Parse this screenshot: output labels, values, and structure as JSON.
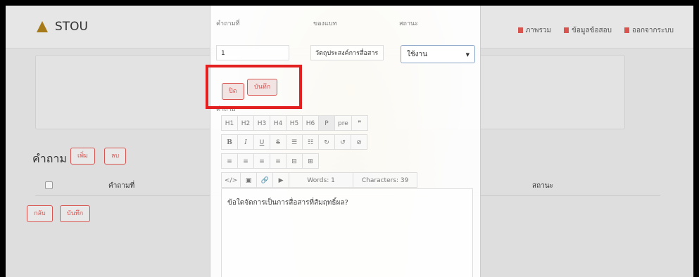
{
  "navbar": {
    "brand": "STOU",
    "links": [
      "ภาพรวม",
      "ข้อมูลข้อสอบ",
      "ออกจากระบบ"
    ]
  },
  "section": {
    "title": "คำถาม",
    "add_label": "เพิ่ม",
    "delete_label": "ลบ",
    "columns": [
      "คำถามที่",
      "สถานะ"
    ],
    "back_label": "กลับ",
    "save_label": "บันทึก"
  },
  "modal": {
    "question_no_label": "คำถามที่",
    "question_no_value": "1",
    "objective_label": "ของแบท",
    "objective_value": "วัตถุประสงค์การสื่อสาร",
    "status_label": "สถานะ",
    "status_value": "ใช้งาน",
    "close_label": "ปิด",
    "save_label": "บันทึก",
    "editor_label": "คำถาม",
    "toolbar_row1": [
      "H1",
      "H2",
      "H3",
      "H4",
      "H5",
      "H6",
      "P",
      "pre",
      "❞"
    ],
    "toolbar_row2": [
      "B",
      "I",
      "U",
      "S",
      "☰",
      "☷",
      "↻",
      "↺",
      "⊘"
    ],
    "toolbar_row3": [
      "≡",
      "≡",
      "≡",
      "≡",
      "⊟",
      "⊞"
    ],
    "toolbar_row4": [
      "</>",
      "▣",
      "🔗",
      "▶"
    ],
    "words": "Words: 1",
    "characters": "Characters: 39",
    "editor_text": "ข้อใดจัดการเป็นการสื่อสารที่สัมฤทธิ์ผล?"
  }
}
